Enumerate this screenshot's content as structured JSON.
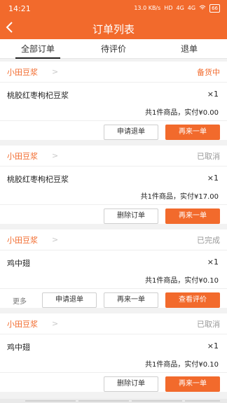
{
  "statusbar": {
    "time": "14:21",
    "net_speed": "13.0 KB/s",
    "sim1": "HD",
    "sim2": "4G",
    "sim3": "4G",
    "battery": "66"
  },
  "header": {
    "title": "订单列表"
  },
  "tabs": [
    {
      "label": "全部订单"
    },
    {
      "label": "待评价"
    },
    {
      "label": "退单"
    }
  ],
  "orders": [
    {
      "shop": "小田豆浆",
      "status": "备货中",
      "product": "桃胶红枣枸杞豆浆",
      "qty": "×1",
      "summary": "共1件商品，实付¥0.00",
      "buttons": [
        "申请退单",
        "再来一单"
      ]
    },
    {
      "shop": "小田豆浆",
      "status": "已取消",
      "product": "桃胶红枣枸杞豆浆",
      "qty": "×1",
      "summary": "共1件商品，实付¥17.00",
      "buttons": [
        "删除订单",
        "再来一单"
      ]
    },
    {
      "shop": "小田豆浆",
      "status": "已完成",
      "product": "鸡中翅",
      "qty": "×1",
      "summary": "共1件商品，实付¥0.10",
      "more": "更多",
      "buttons": [
        "申请退单",
        "再来一单",
        "查看评价"
      ]
    },
    {
      "shop": "小田豆浆",
      "status": "已取消",
      "product": "鸡中翅",
      "qty": "×1",
      "summary": "共1件商品，实付¥0.10",
      "buttons": [
        "删除订单",
        "再来一单"
      ]
    }
  ],
  "colors": {
    "accent": "#f26a2c",
    "background": "#f2f2f2"
  }
}
